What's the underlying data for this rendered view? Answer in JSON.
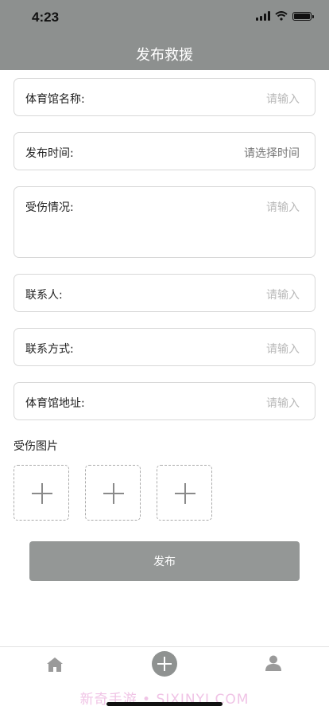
{
  "status_bar": {
    "time": "4:23"
  },
  "header": {
    "title": "发布救援"
  },
  "form": {
    "venue_name": {
      "label": "体育馆名称:",
      "placeholder": "请输入"
    },
    "publish_time": {
      "label": "发布时间:",
      "placeholder": "请选择时间"
    },
    "injury": {
      "label": "受伤情况:",
      "placeholder": "请输入"
    },
    "contact": {
      "label": "联系人:",
      "placeholder": "请输入"
    },
    "contact_method": {
      "label": "联系方式:",
      "placeholder": "请输入"
    },
    "venue_address": {
      "label": "体育馆地址:",
      "placeholder": "请输入"
    }
  },
  "images": {
    "label": "受伤图片",
    "slots": 3
  },
  "submit_label": "发布",
  "tabbar": {
    "icons": [
      "home-icon",
      "add-icon",
      "user-icon"
    ]
  },
  "watermark": "新奇手游 • SIXINYI.COM"
}
